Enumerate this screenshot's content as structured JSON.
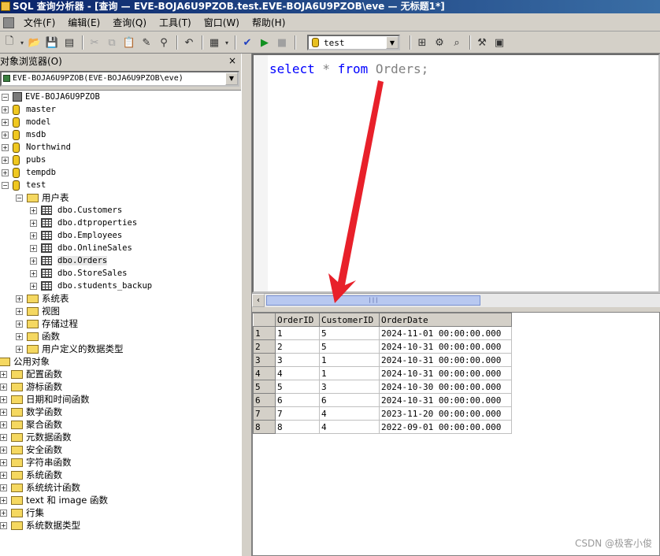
{
  "window": {
    "title": "SQL 查询分析器 - [查询 — EVE-BOJA6U9PZOB.test.EVE-BOJA6U9PZOB\\eve — 无标题1*]"
  },
  "menu": [
    "文件(F)",
    "编辑(E)",
    "查询(Q)",
    "工具(T)",
    "窗口(W)",
    "帮助(H)"
  ],
  "toolbar": {
    "database": "test"
  },
  "object_browser": {
    "title": "对象浏览器(O)",
    "close": "×",
    "server_combo": "EVE-BOJA6U9PZOB(EVE-BOJA6U9PZOB\\eve)",
    "server_node": "EVE-BOJA6U9PZOB",
    "databases": [
      "master",
      "model",
      "msdb",
      "Northwind",
      "pubs",
      "tempdb",
      "test"
    ],
    "user_tables_label": "用户表",
    "tables": [
      "dbo.Customers",
      "dbo.dtproperties",
      "dbo.Employees",
      "dbo.OnlineSales",
      "dbo.Orders",
      "dbo.StoreSales",
      "dbo.students_backup"
    ],
    "test_children": [
      "系统表",
      "视图",
      "存储过程",
      "函数",
      "用户定义的数据类型"
    ],
    "common_objects": "公用对象",
    "common_children": [
      "配置函数",
      "游标函数",
      "日期和时间函数",
      "数学函数",
      "聚合函数",
      "元数据函数",
      "安全函数",
      "字符串函数",
      "系统函数",
      "系统统计函数",
      "text 和 image 函数",
      "行集",
      "系统数据类型"
    ]
  },
  "editor": {
    "keyword1": "select",
    "star": " * ",
    "keyword2": "from",
    "rest": " Orders;"
  },
  "results": {
    "columns": [
      "OrderID",
      "CustomerID",
      "OrderDate"
    ],
    "rows": [
      [
        "1",
        "1",
        "5",
        "2024-11-01 00:00:00.000"
      ],
      [
        "2",
        "2",
        "5",
        "2024-10-31 00:00:00.000"
      ],
      [
        "3",
        "3",
        "1",
        "2024-10-31 00:00:00.000"
      ],
      [
        "4",
        "4",
        "1",
        "2024-10-31 00:00:00.000"
      ],
      [
        "5",
        "5",
        "3",
        "2024-10-30 00:00:00.000"
      ],
      [
        "6",
        "6",
        "6",
        "2024-10-31 00:00:00.000"
      ],
      [
        "7",
        "7",
        "4",
        "2023-11-20 00:00:00.000"
      ],
      [
        "8",
        "8",
        "4",
        "2022-09-01 00:00:00.000"
      ]
    ]
  },
  "watermark": "CSDN @极客小俊",
  "colors": {
    "title_bar": "#0a246a",
    "keyword": "#0000ff",
    "arrow": "#e8202a"
  }
}
